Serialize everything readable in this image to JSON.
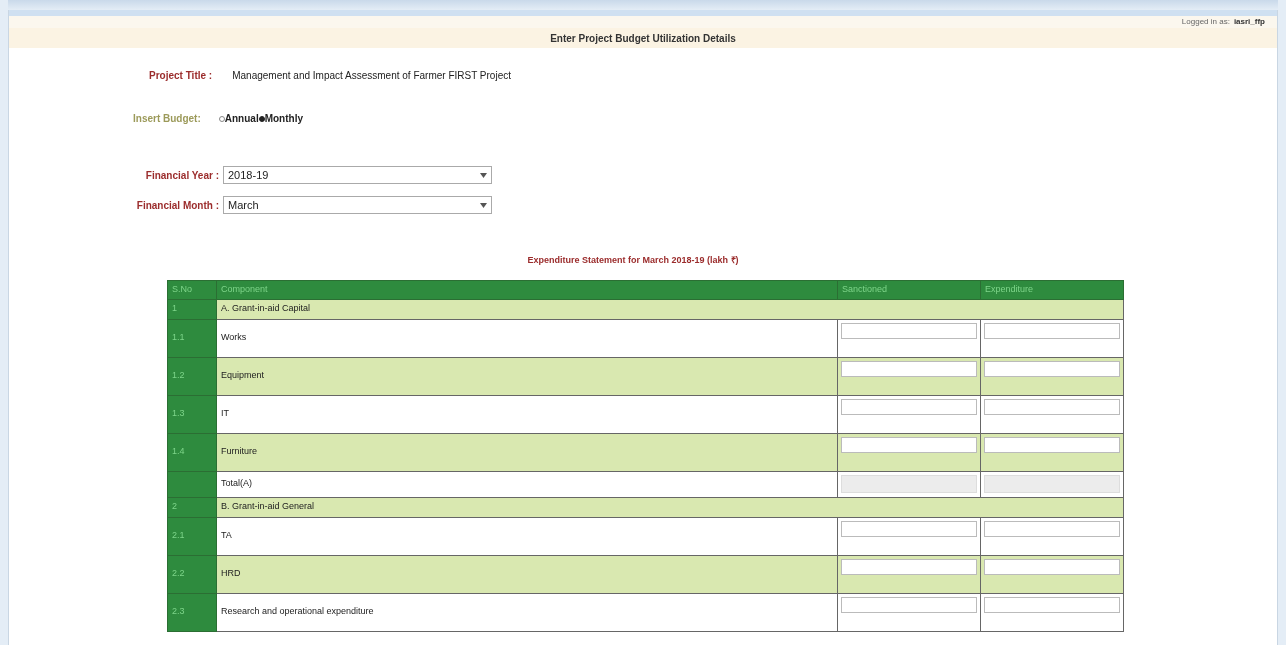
{
  "header": {
    "logged_in_label": "Logged in as:",
    "user": "iasri_ffp",
    "title": "Enter Project Budget Utilization Details"
  },
  "project_title": {
    "label": "Project Title :",
    "value": "Management and Impact Assessment of Farmer FIRST Project"
  },
  "insert_budget": {
    "label": "Insert Budget:",
    "options": [
      {
        "label": "Annual",
        "selected": false
      },
      {
        "label": "Monthly",
        "selected": true
      }
    ]
  },
  "financial_year": {
    "label": "Financial Year :",
    "value": "2018-19"
  },
  "financial_month": {
    "label": "Financial Month :",
    "value": "March"
  },
  "statement_title": "Expenditure Statement for March 2018-19 (lakh ₹)",
  "table": {
    "columns": [
      "S.No",
      "Component",
      "Sanctioned",
      "Expenditure"
    ],
    "rows": [
      {
        "kind": "section",
        "sno": "1",
        "component": "A. Grant-in-aid Capital"
      },
      {
        "kind": "item",
        "sno": "1.1",
        "component": "Works"
      },
      {
        "kind": "item",
        "sno": "1.2",
        "component": "Equipment"
      },
      {
        "kind": "item",
        "sno": "1.3",
        "component": "IT"
      },
      {
        "kind": "item",
        "sno": "1.4",
        "component": "Furniture"
      },
      {
        "kind": "total",
        "component": "Total(A)"
      },
      {
        "kind": "section",
        "sno": "2",
        "component": "B. Grant-in-aid General"
      },
      {
        "kind": "item",
        "sno": "2.1",
        "component": "TA"
      },
      {
        "kind": "item",
        "sno": "2.2",
        "component": "HRD"
      },
      {
        "kind": "item",
        "sno": "2.3",
        "component": "Research and operational expenditure"
      }
    ]
  }
}
